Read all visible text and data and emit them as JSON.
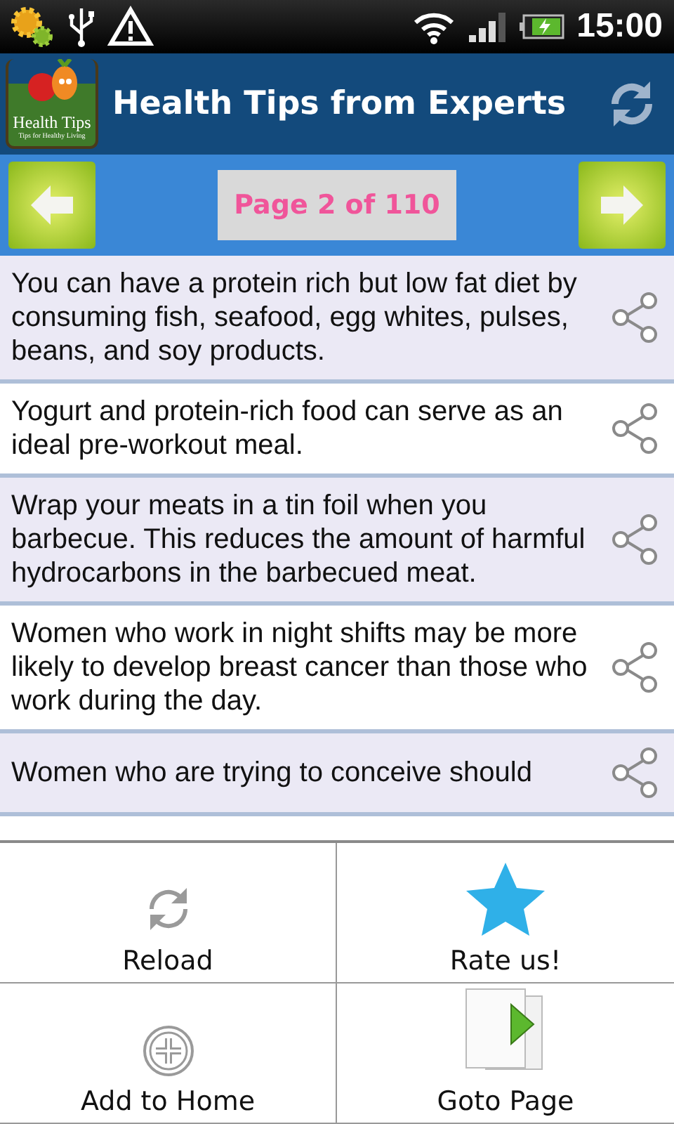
{
  "status_bar": {
    "time": "15:00"
  },
  "app_bar": {
    "logo_title": "Health Tips",
    "logo_subtitle": "Tips for Healthy Living",
    "title": "Health Tips from Experts"
  },
  "pager": {
    "label": "Page 2 of 110"
  },
  "tips": [
    {
      "text": "You can have a protein rich but low fat diet by consuming fish, seafood, egg whites, pulses, beans, and soy products."
    },
    {
      "text": "Yogurt and protein-rich food can serve as an ideal pre-workout meal."
    },
    {
      "text": "Wrap your meats in a tin foil when you barbecue. This reduces the amount of harmful hydrocarbons in the barbecued meat."
    },
    {
      "text": "Women who work in night shifts may be more likely to develop breast cancer than those who work during the day."
    },
    {
      "text": "Women who are trying to conceive should"
    }
  ],
  "menu": [
    {
      "label": "Reload"
    },
    {
      "label": "Rate us!"
    },
    {
      "label": "Add to Home"
    },
    {
      "label": "Goto Page"
    }
  ]
}
